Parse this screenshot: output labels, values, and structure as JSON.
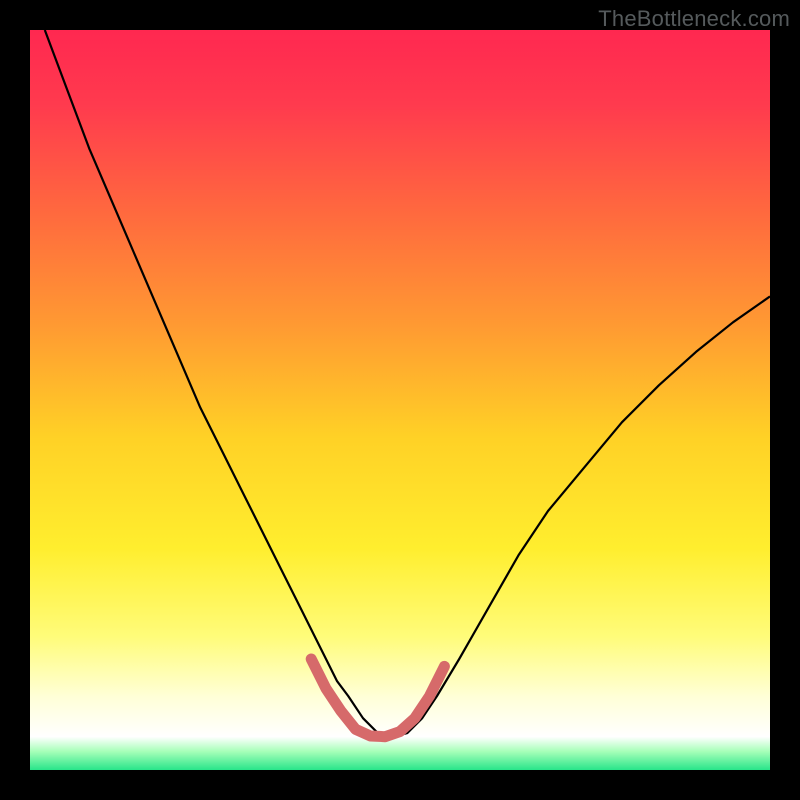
{
  "watermark": "TheBottleneck.com",
  "chart_data": {
    "type": "line",
    "title": "",
    "xlabel": "",
    "ylabel": "",
    "xlim": [
      0,
      100
    ],
    "ylim": [
      0,
      100
    ],
    "grid": false,
    "legend": false,
    "background": {
      "type": "vertical-gradient",
      "stops": [
        {
          "pos": 0.0,
          "color": "#ff2850"
        },
        {
          "pos": 0.1,
          "color": "#ff3a4e"
        },
        {
          "pos": 0.25,
          "color": "#ff6a3e"
        },
        {
          "pos": 0.4,
          "color": "#ff9a32"
        },
        {
          "pos": 0.55,
          "color": "#ffd126"
        },
        {
          "pos": 0.7,
          "color": "#ffee2e"
        },
        {
          "pos": 0.82,
          "color": "#fffc7a"
        },
        {
          "pos": 0.9,
          "color": "#ffffd6"
        },
        {
          "pos": 0.955,
          "color": "#ffffff"
        },
        {
          "pos": 0.975,
          "color": "#a6ffb8"
        },
        {
          "pos": 1.0,
          "color": "#28e58a"
        }
      ]
    },
    "series": [
      {
        "name": "bottleneck-curve",
        "stroke": "#000000",
        "stroke_width": 2.2,
        "x": [
          2,
          5,
          8,
          11,
          14,
          17,
          20,
          23,
          26,
          29,
          32,
          34,
          36,
          38,
          40,
          41.5,
          43,
          45,
          47,
          49,
          51,
          53,
          55,
          58,
          62,
          66,
          70,
          75,
          80,
          85,
          90,
          95,
          100
        ],
        "y": [
          100,
          92,
          84,
          77,
          70,
          63,
          56,
          49,
          43,
          37,
          31,
          27,
          23,
          19,
          15,
          12,
          10,
          7,
          5,
          4.5,
          5,
          7,
          10,
          15,
          22,
          29,
          35,
          41,
          47,
          52,
          56.5,
          60.5,
          64
        ]
      },
      {
        "name": "bottom-highlight",
        "stroke": "#d66a6a",
        "stroke_width": 11,
        "linecap": "round",
        "x": [
          38,
          40,
          42,
          44,
          46,
          48,
          50,
          52,
          54,
          56
        ],
        "y": [
          15,
          11,
          8,
          5.5,
          4.6,
          4.5,
          5.2,
          7,
          10,
          14
        ]
      }
    ]
  }
}
